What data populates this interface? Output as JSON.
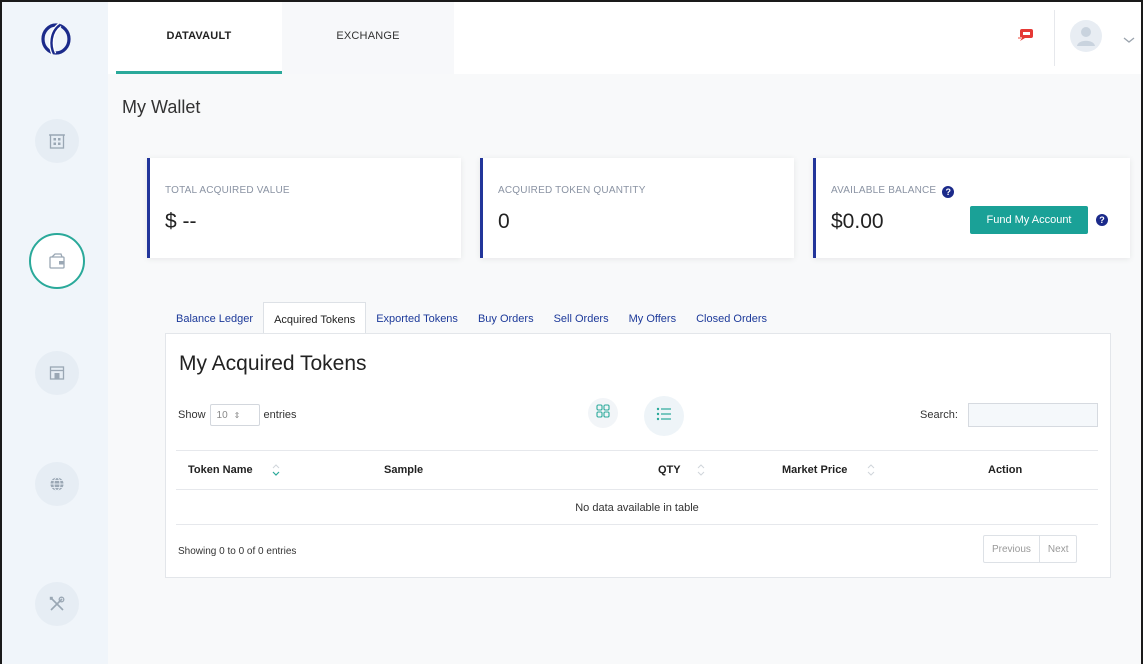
{
  "nav": {
    "tabs": [
      {
        "label": "DATAVAULT"
      },
      {
        "label": "EXCHANGE"
      }
    ],
    "sidebar_icons": [
      "building-icon",
      "wallet-icon",
      "storefront-icon",
      "globe-icon",
      "tools-icon"
    ]
  },
  "page": {
    "title": "My Wallet"
  },
  "cards": {
    "total_acquired_value": {
      "label": "TOTAL ACQUIRED VALUE",
      "value": "$ --"
    },
    "acquired_token_quantity": {
      "label": "ACQUIRED TOKEN QUANTITY",
      "value": "0"
    },
    "available_balance": {
      "label": "AVAILABLE BALANCE",
      "value": "$0.00",
      "button": "Fund My Account"
    }
  },
  "subtabs": [
    {
      "label": "Balance Ledger"
    },
    {
      "label": "Acquired Tokens"
    },
    {
      "label": "Exported Tokens"
    },
    {
      "label": "Buy Orders"
    },
    {
      "label": "Sell Orders"
    },
    {
      "label": "My Offers"
    },
    {
      "label": "Closed Orders"
    }
  ],
  "active_subtab": "Acquired Tokens",
  "table": {
    "title": "My Acquired Tokens",
    "show_label": "Show",
    "entries_label": "entries",
    "page_size": "10",
    "search_label": "Search:",
    "columns": [
      "Token Name",
      "Sample",
      "QTY",
      "Market Price",
      "Action"
    ],
    "empty_message": "No data available in table",
    "info": "Showing 0 to 0 of 0 entries",
    "previous": "Previous",
    "next": "Next"
  },
  "colors": {
    "accent_teal": "#1aa197",
    "card_border_navy": "#22359a",
    "link_blue": "#1d3a9a",
    "notification_red": "#e53935"
  }
}
